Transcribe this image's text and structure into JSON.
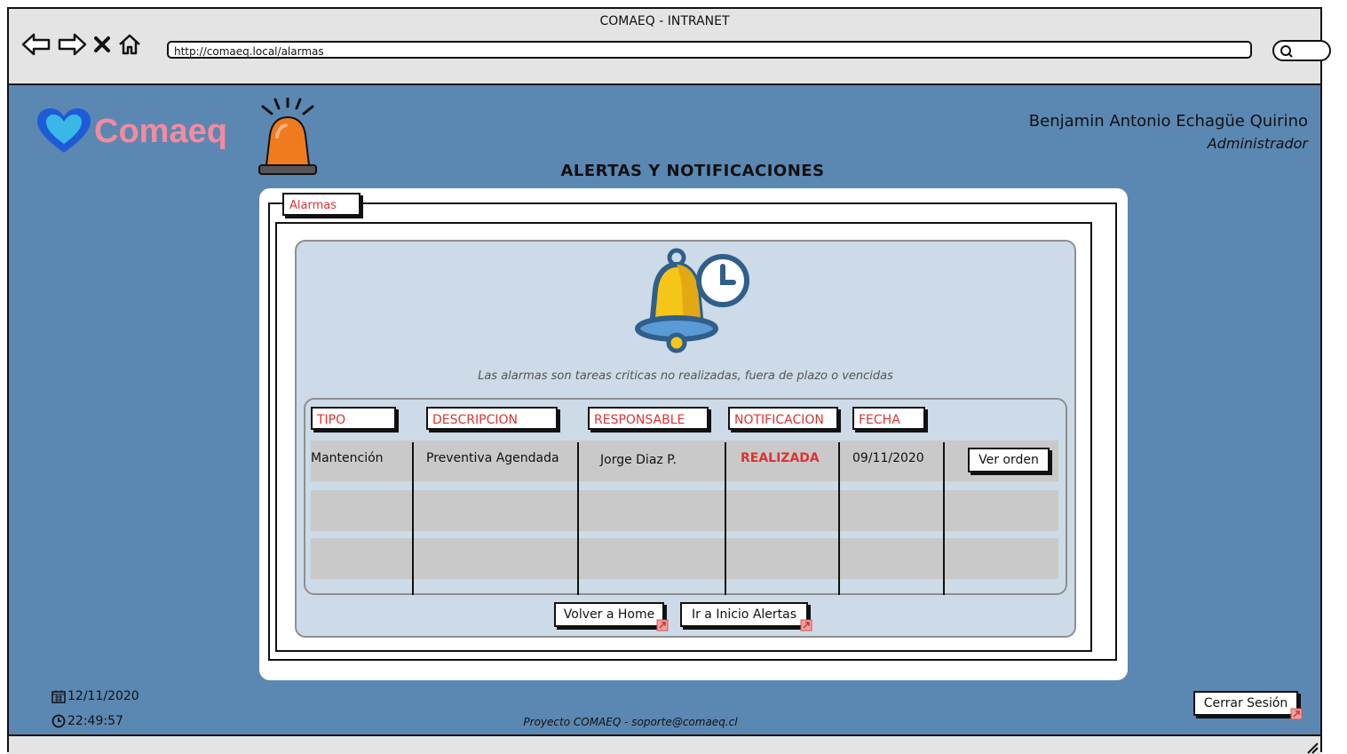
{
  "window": {
    "title": "COMAEQ - INTRANET",
    "url": "http://comaeq.local/alarmas"
  },
  "brand": {
    "logo_text": "Comaeq"
  },
  "user": {
    "name": "Benjamin Antonio Echagüe Quirino",
    "role": "Administrador"
  },
  "page": {
    "title": "ALERTAS Y NOTIFICACIONES"
  },
  "group": {
    "label": "Alarmas"
  },
  "panel": {
    "description": "Las alarmas son tareas criticas no realizadas, fuera de plazo o vencidas"
  },
  "table": {
    "headers": [
      "TIPO",
      "DESCRIPCION",
      "RESPONSABLE",
      "NOTIFICACION",
      "FECHA"
    ],
    "rows": [
      {
        "tipo": "Mantención",
        "descripcion": "Preventiva Agendada",
        "responsable": "Jorge Diaz P.",
        "notificacion": "REALIZADA",
        "fecha": "09/11/2020",
        "action": "Ver orden"
      }
    ]
  },
  "buttons": {
    "home": "Volver a Home",
    "alerts_home": "Ir a Inicio Alertas",
    "logout": "Cerrar Sesión"
  },
  "status": {
    "date": "12/11/2020",
    "time": "22:49:57"
  },
  "footer": {
    "text": "Proyecto COMAEQ - soporte@comaeq.cl"
  },
  "colors": {
    "background": "#5b88b2",
    "accent_red": "#d33333",
    "panel": "#ccdbe7",
    "logo_heart": "#1f5bd6",
    "logo_text": "#f58a9e",
    "bell": "#f5c518",
    "siren": "#f07a1e"
  },
  "icons": [
    "back-arrow-icon",
    "forward-arrow-icon",
    "stop-icon",
    "home-icon",
    "search-icon",
    "heart-logo-icon",
    "siren-icon",
    "bell-clock-icon",
    "calendar-icon",
    "clock-icon",
    "link-icon",
    "resize-grip-icon"
  ]
}
